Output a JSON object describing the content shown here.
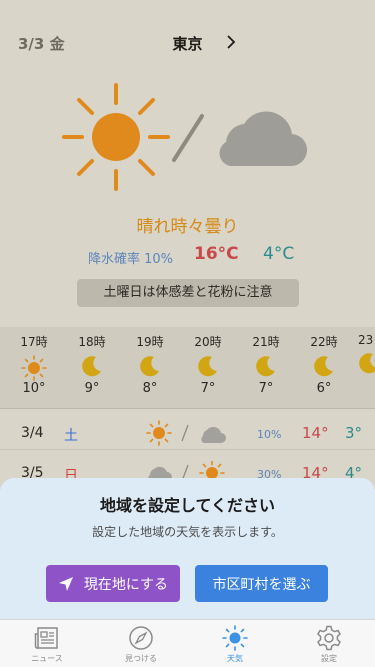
{
  "header": {
    "date": "3/3 金",
    "city": "東京"
  },
  "today": {
    "forecast": "晴れ時々曇り",
    "precip": "降水確率 10%",
    "high": "16°C",
    "low": "4°C",
    "notice": "土曜日は体感差と花粉に注意"
  },
  "hourly": [
    {
      "time": "17時",
      "icon": "sun-icon",
      "temp": "10°"
    },
    {
      "time": "18時",
      "icon": "moon-icon",
      "temp": "9°"
    },
    {
      "time": "19時",
      "icon": "moon-icon",
      "temp": "8°"
    },
    {
      "time": "20時",
      "icon": "moon-icon",
      "temp": "7°"
    },
    {
      "time": "21時",
      "icon": "moon-icon",
      "temp": "7°"
    },
    {
      "time": "22時",
      "icon": "moon-icon",
      "temp": "6°"
    },
    {
      "time": "23",
      "icon": "moon-icon",
      "temp": ""
    }
  ],
  "daily": [
    {
      "date": "3/4",
      "weekday": "土",
      "weekday_color": "#3a6fd8",
      "icon1": "sun-icon",
      "icon2": "cloud-icon",
      "precip": "10%",
      "high": "14°",
      "low": "3°"
    },
    {
      "date": "3/5",
      "weekday": "日",
      "weekday_color": "#d0433f",
      "icon1": "cloud-icon",
      "icon2": "sun-icon",
      "precip": "30%",
      "high": "14°",
      "low": "4°"
    }
  ],
  "sheet": {
    "title": "地域を設定してください",
    "subtitle": "設定した地域の天気を表示します。",
    "location_button": "現在地にする",
    "city_button": "市区町村を選ぶ"
  },
  "tabs": [
    {
      "label": "ニュース",
      "icon": "newspaper-icon",
      "active": false
    },
    {
      "label": "見つける",
      "icon": "compass-icon",
      "active": false
    },
    {
      "label": "天気",
      "icon": "sun-icon",
      "active": true
    },
    {
      "label": "設定",
      "icon": "gear-icon",
      "active": false
    }
  ],
  "colors": {
    "accent_orange": "#d68a16",
    "temp_high": "#c9484a",
    "temp_low": "#2f8b8b",
    "location_button": "#8e54c7",
    "city_button": "#3a82de",
    "tab_active": "#3a93e6"
  }
}
